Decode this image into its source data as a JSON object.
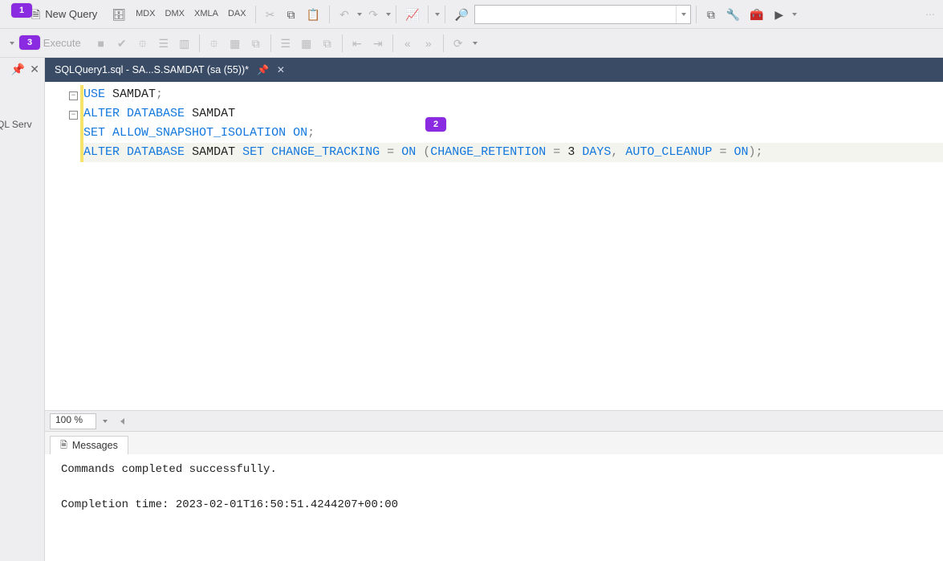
{
  "badges": {
    "b1": "1",
    "b2": "2",
    "b3": "3"
  },
  "toolbar1": {
    "new_query_label": "New Query",
    "icons": {
      "new_query": "🗎",
      "db1": "🗄",
      "mdx": "MDX",
      "dmx": "DMX",
      "xmla": "XMLA",
      "dax": "DAX",
      "cut": "✂",
      "copy": "⧉",
      "paste": "📋",
      "undo": "↶",
      "redo": "↷",
      "chart": "📈",
      "find": "🔎",
      "vs": "⧉",
      "wrench": "🔧",
      "toolbox": "🧰",
      "play": "▶"
    }
  },
  "toolbar2": {
    "execute_label": "Execute",
    "icons": {
      "play": "▶",
      "stop": "■",
      "check": "✔",
      "plan1": "⯐",
      "plan2": "☰",
      "plan3": "▥",
      "grp": "⯐",
      "tbl": "▦",
      "g2": "⧉",
      "indent_dec": "⇤",
      "indent_inc": "⇥",
      "outdent": "«",
      "indentR": "»",
      "comment": "/*",
      "last": "⟳"
    }
  },
  "left_panel": {
    "pin_glyph": "📌",
    "close_glyph": "✕",
    "label": "QL Serv"
  },
  "document_tab": {
    "title": "SQLQuery1.sql - SA...S.SAMDAT (sa (55))*",
    "pin_glyph": "📌",
    "close_glyph": "✕"
  },
  "sql": {
    "l1_use": "USE",
    "l1_db": "SAMDAT",
    "l1_semi": ";",
    "l2_alter": "ALTER",
    "l2_database": "DATABASE",
    "l2_db": "SAMDAT",
    "l3_set": "SET",
    "l3_opt": "ALLOW_SNAPSHOT_ISOLATION",
    "l3_on": "ON",
    "l3_semi": ";",
    "l4_alter": "ALTER",
    "l4_database": "DATABASE",
    "l4_db": "SAMDAT",
    "l4_set": "SET",
    "l4_ct": "CHANGE_TRACKING",
    "l4_eq": "=",
    "l4_on": "ON",
    "l4_lpar": "(",
    "l4_cr": "CHANGE_RETENTION",
    "l4_eq2": "=",
    "l4_3": "3",
    "l4_days": "DAYS",
    "l4_comma": ",",
    "l4_ac": "AUTO_CLEANUP",
    "l4_eq3": "=",
    "l4_on2": "ON",
    "l4_rpar": ")",
    "l4_semi": ";"
  },
  "zoom": {
    "value": "100 %"
  },
  "messages_tab": {
    "label": "Messages",
    "icon": "🗎"
  },
  "messages_body": "Commands completed successfully.\n\nCompletion time: 2023-02-01T16:50:51.4244207+00:00"
}
